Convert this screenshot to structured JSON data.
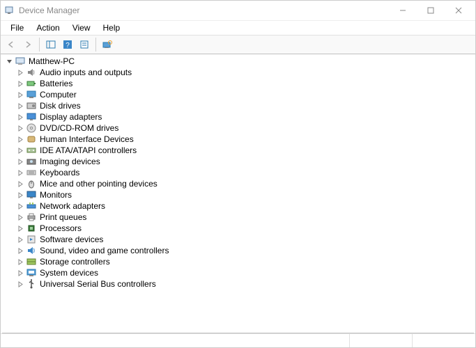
{
  "window": {
    "title": "Device Manager"
  },
  "menu": {
    "file": "File",
    "action": "Action",
    "view": "View",
    "help": "Help"
  },
  "root": {
    "name": "Matthew-PC"
  },
  "categories": [
    {
      "label": "Audio inputs and outputs",
      "icon": "speaker"
    },
    {
      "label": "Batteries",
      "icon": "battery"
    },
    {
      "label": "Computer",
      "icon": "computer"
    },
    {
      "label": "Disk drives",
      "icon": "disk"
    },
    {
      "label": "Display adapters",
      "icon": "display"
    },
    {
      "label": "DVD/CD-ROM drives",
      "icon": "dvd"
    },
    {
      "label": "Human Interface Devices",
      "icon": "hid"
    },
    {
      "label": "IDE ATA/ATAPI controllers",
      "icon": "ide"
    },
    {
      "label": "Imaging devices",
      "icon": "imaging"
    },
    {
      "label": "Keyboards",
      "icon": "keyboard"
    },
    {
      "label": "Mice and other pointing devices",
      "icon": "mouse"
    },
    {
      "label": "Monitors",
      "icon": "monitor"
    },
    {
      "label": "Network adapters",
      "icon": "network"
    },
    {
      "label": "Print queues",
      "icon": "printer"
    },
    {
      "label": "Processors",
      "icon": "cpu"
    },
    {
      "label": "Software devices",
      "icon": "software"
    },
    {
      "label": "Sound, video and game controllers",
      "icon": "sound"
    },
    {
      "label": "Storage controllers",
      "icon": "storage"
    },
    {
      "label": "System devices",
      "icon": "system"
    },
    {
      "label": "Universal Serial Bus controllers",
      "icon": "usb"
    }
  ]
}
